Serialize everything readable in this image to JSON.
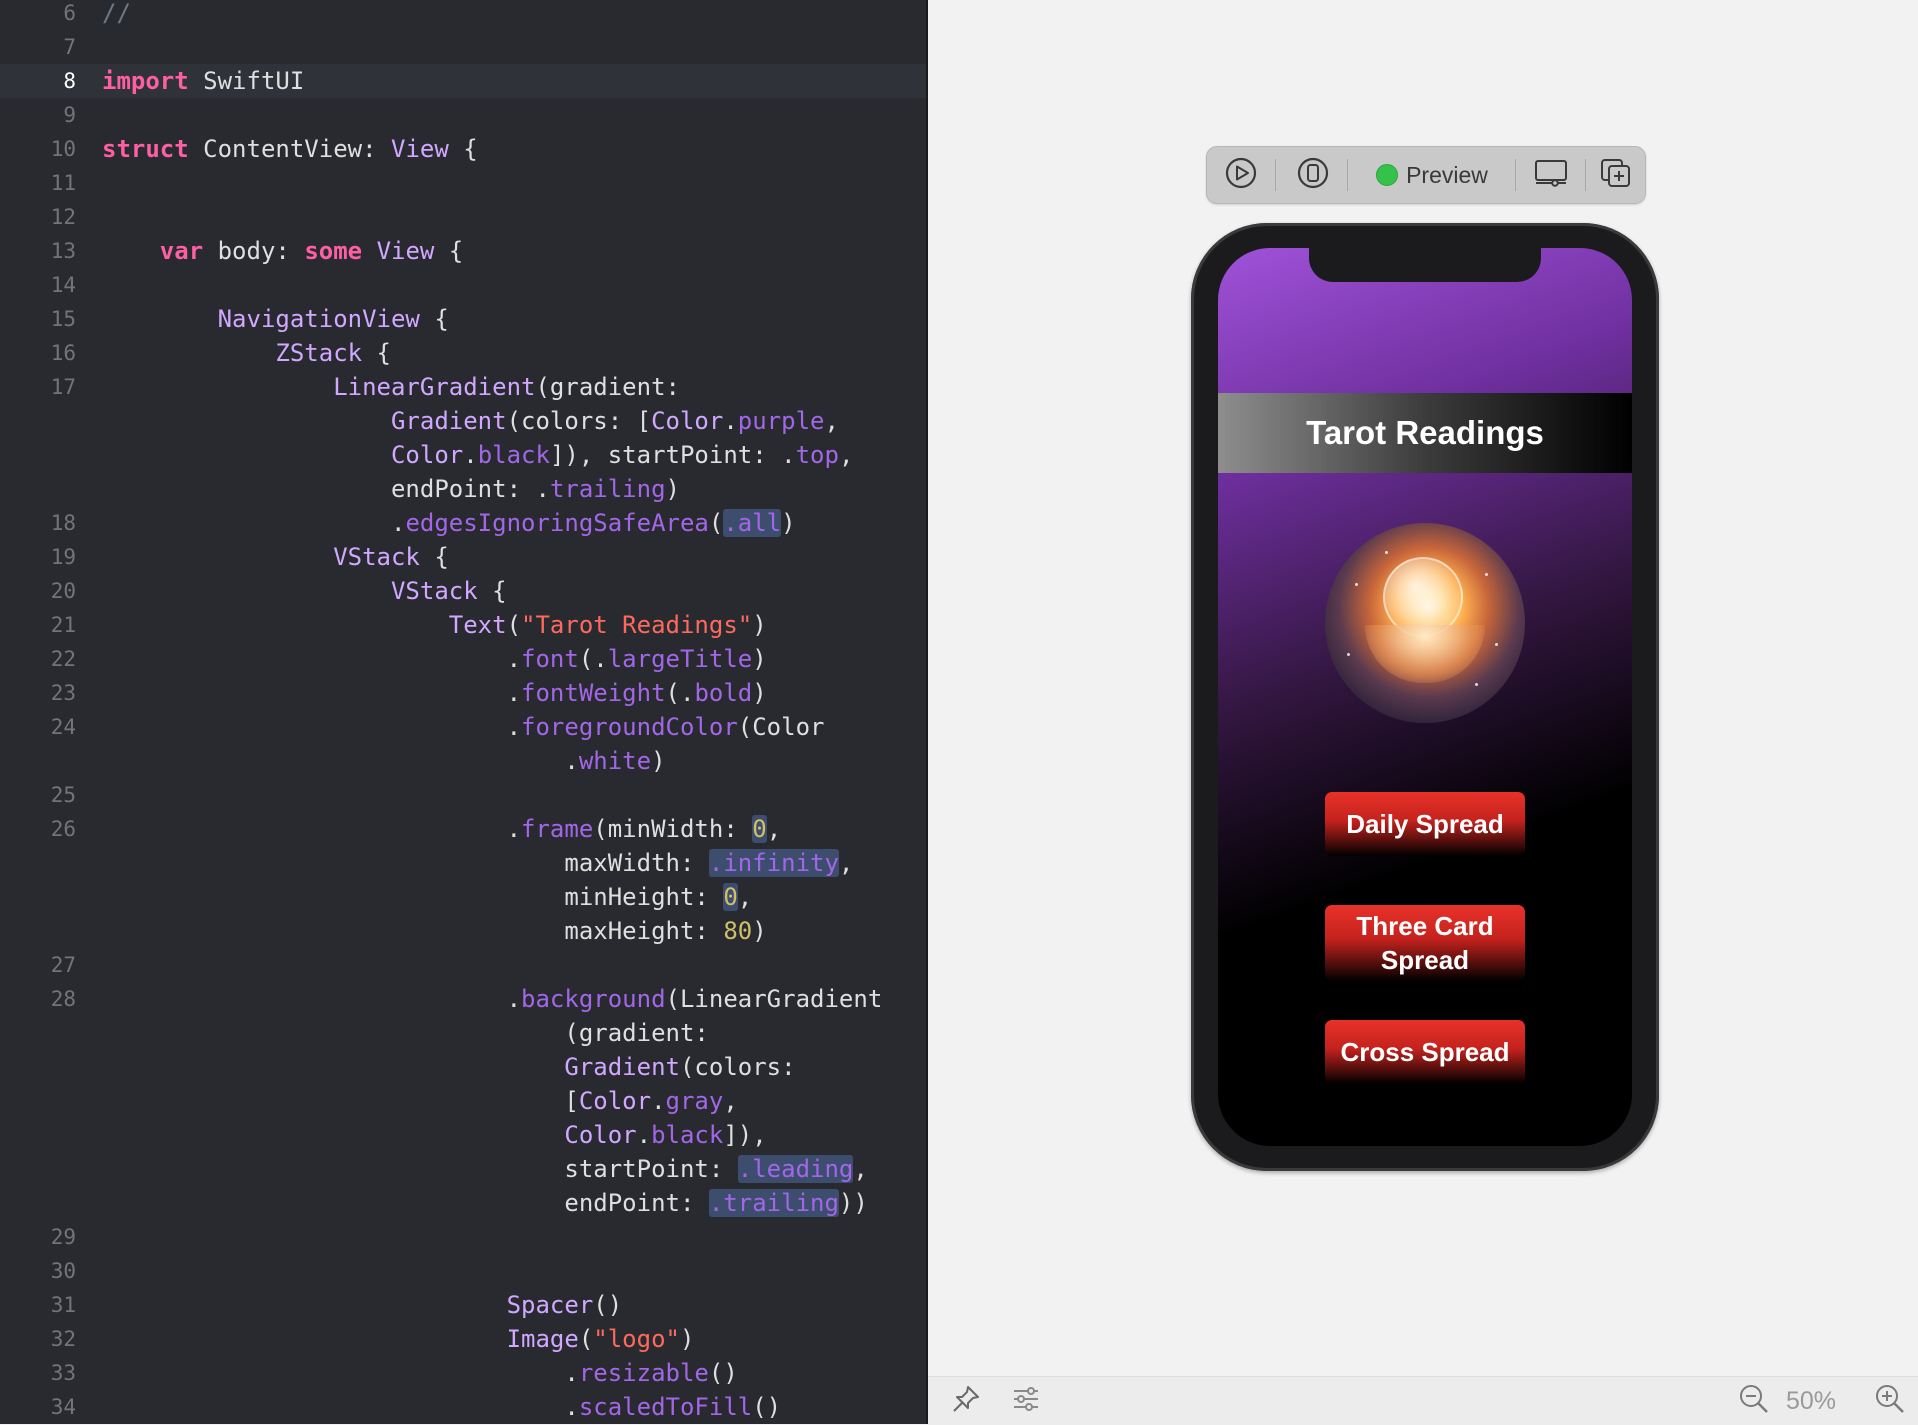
{
  "editor": {
    "lines": [
      {
        "num": "6",
        "tokens": [
          {
            "t": "//",
            "c": "k-com"
          }
        ]
      },
      {
        "num": "7",
        "tokens": []
      },
      {
        "num": "8",
        "current": true,
        "tokens": [
          {
            "t": "import",
            "c": "k-key"
          },
          {
            "t": " SwiftUI"
          }
        ]
      },
      {
        "num": "9",
        "tokens": []
      },
      {
        "num": "10",
        "tokens": [
          {
            "t": "struct",
            "c": "k-key"
          },
          {
            "t": " ContentView: "
          },
          {
            "t": "View",
            "c": "k-type"
          },
          {
            "t": " {"
          }
        ]
      },
      {
        "num": "11",
        "tokens": []
      },
      {
        "num": "12",
        "tokens": []
      },
      {
        "num": "13",
        "tokens": [
          {
            "t": "    "
          },
          {
            "t": "var",
            "c": "k-key"
          },
          {
            "t": " body: "
          },
          {
            "t": "some",
            "c": "k-key"
          },
          {
            "t": " "
          },
          {
            "t": "View",
            "c": "k-type"
          },
          {
            "t": " {"
          }
        ]
      },
      {
        "num": "14",
        "tokens": []
      },
      {
        "num": "15",
        "tokens": [
          {
            "t": "        "
          },
          {
            "t": "NavigationView",
            "c": "k-type"
          },
          {
            "t": " {"
          }
        ]
      },
      {
        "num": "16",
        "tokens": [
          {
            "t": "            "
          },
          {
            "t": "ZStack",
            "c": "k-type"
          },
          {
            "t": " {"
          }
        ]
      },
      {
        "num": "17",
        "tokens": [
          {
            "t": "                "
          },
          {
            "t": "LinearGradient",
            "c": "k-type"
          },
          {
            "t": "(gradient:"
          }
        ]
      },
      {
        "num": "",
        "tokens": [
          {
            "t": "                    "
          },
          {
            "t": "Gradient",
            "c": "k-type"
          },
          {
            "t": "(colors: ["
          },
          {
            "t": "Color",
            "c": "k-type"
          },
          {
            "t": "."
          },
          {
            "t": "purple",
            "c": "k-prop"
          },
          {
            "t": ","
          }
        ]
      },
      {
        "num": "",
        "tokens": [
          {
            "t": "                    "
          },
          {
            "t": "Color",
            "c": "k-type"
          },
          {
            "t": "."
          },
          {
            "t": "black",
            "c": "k-prop"
          },
          {
            "t": "]), startPoint: ."
          },
          {
            "t": "top",
            "c": "k-prop"
          },
          {
            "t": ","
          }
        ]
      },
      {
        "num": "",
        "tokens": [
          {
            "t": "                    endPoint: ."
          },
          {
            "t": "trailing",
            "c": "k-prop"
          },
          {
            "t": ")"
          }
        ]
      },
      {
        "num": "18",
        "tokens": [
          {
            "t": "                    ."
          },
          {
            "t": "edgesIgnoringSafeArea",
            "c": "k-prop"
          },
          {
            "t": "("
          },
          {
            "t": ".all",
            "c": "k-prop hl"
          },
          {
            "t": ")"
          }
        ]
      },
      {
        "num": "19",
        "tokens": [
          {
            "t": "                "
          },
          {
            "t": "VStack",
            "c": "k-type"
          },
          {
            "t": " {"
          }
        ]
      },
      {
        "num": "20",
        "tokens": [
          {
            "t": "                    "
          },
          {
            "t": "VStack",
            "c": "k-type"
          },
          {
            "t": " {"
          }
        ]
      },
      {
        "num": "21",
        "tokens": [
          {
            "t": "                        "
          },
          {
            "t": "Text",
            "c": "k-type"
          },
          {
            "t": "("
          },
          {
            "t": "\"Tarot Readings\"",
            "c": "k-str"
          },
          {
            "t": ")"
          }
        ]
      },
      {
        "num": "22",
        "tokens": [
          {
            "t": "                            ."
          },
          {
            "t": "font",
            "c": "k-prop"
          },
          {
            "t": "(."
          },
          {
            "t": "largeTitle",
            "c": "k-prop"
          },
          {
            "t": ")"
          }
        ]
      },
      {
        "num": "23",
        "tokens": [
          {
            "t": "                            ."
          },
          {
            "t": "fontWeight",
            "c": "k-prop"
          },
          {
            "t": "(."
          },
          {
            "t": "bold",
            "c": "k-prop"
          },
          {
            "t": ")"
          }
        ]
      },
      {
        "num": "24",
        "tokens": [
          {
            "t": "                            ."
          },
          {
            "t": "foregroundColor",
            "c": "k-prop"
          },
          {
            "t": "(Color"
          }
        ]
      },
      {
        "num": "",
        "tokens": [
          {
            "t": "                                ."
          },
          {
            "t": "white",
            "c": "k-prop"
          },
          {
            "t": ")"
          }
        ]
      },
      {
        "num": "25",
        "tokens": []
      },
      {
        "num": "26",
        "tokens": [
          {
            "t": "                            ."
          },
          {
            "t": "frame",
            "c": "k-prop"
          },
          {
            "t": "(minWidth: "
          },
          {
            "t": "0",
            "c": "k-num hl"
          },
          {
            "t": ","
          }
        ]
      },
      {
        "num": "",
        "tokens": [
          {
            "t": "                                maxWidth: "
          },
          {
            "t": ".infinity",
            "c": "k-prop hl"
          },
          {
            "t": ","
          }
        ]
      },
      {
        "num": "",
        "tokens": [
          {
            "t": "                                minHeight: "
          },
          {
            "t": "0",
            "c": "k-num hl"
          },
          {
            "t": ","
          }
        ]
      },
      {
        "num": "",
        "tokens": [
          {
            "t": "                                maxHeight: "
          },
          {
            "t": "80",
            "c": "k-num"
          },
          {
            "t": ")"
          }
        ]
      },
      {
        "num": "27",
        "tokens": []
      },
      {
        "num": "28",
        "tokens": [
          {
            "t": "                            ."
          },
          {
            "t": "background",
            "c": "k-prop"
          },
          {
            "t": "(LinearGradient"
          }
        ]
      },
      {
        "num": "",
        "tokens": [
          {
            "t": "                                (gradient:"
          }
        ]
      },
      {
        "num": "",
        "tokens": [
          {
            "t": "                                "
          },
          {
            "t": "Gradient",
            "c": "k-type"
          },
          {
            "t": "(colors:"
          }
        ]
      },
      {
        "num": "",
        "tokens": [
          {
            "t": "                                ["
          },
          {
            "t": "Color",
            "c": "k-type"
          },
          {
            "t": "."
          },
          {
            "t": "gray",
            "c": "k-prop"
          },
          {
            "t": ","
          }
        ]
      },
      {
        "num": "",
        "tokens": [
          {
            "t": "                                "
          },
          {
            "t": "Color",
            "c": "k-type"
          },
          {
            "t": "."
          },
          {
            "t": "black",
            "c": "k-prop"
          },
          {
            "t": "]),"
          }
        ]
      },
      {
        "num": "",
        "tokens": [
          {
            "t": "                                startPoint: "
          },
          {
            "t": ".leading",
            "c": "k-prop hl"
          },
          {
            "t": ","
          }
        ]
      },
      {
        "num": "",
        "tokens": [
          {
            "t": "                                endPoint: "
          },
          {
            "t": ".trailing",
            "c": "k-prop hl"
          },
          {
            "t": "))"
          }
        ]
      },
      {
        "num": "29",
        "tokens": []
      },
      {
        "num": "30",
        "tokens": []
      },
      {
        "num": "31",
        "tokens": [
          {
            "t": "                            "
          },
          {
            "t": "Spacer",
            "c": "k-type"
          },
          {
            "t": "()"
          }
        ]
      },
      {
        "num": "32",
        "tokens": [
          {
            "t": "                            "
          },
          {
            "t": "Image",
            "c": "k-type"
          },
          {
            "t": "("
          },
          {
            "t": "\"logo\"",
            "c": "k-str"
          },
          {
            "t": ")"
          }
        ]
      },
      {
        "num": "33",
        "tokens": [
          {
            "t": "                                ."
          },
          {
            "t": "resizable",
            "c": "k-prop"
          },
          {
            "t": "()"
          }
        ]
      },
      {
        "num": "34",
        "tokens": [
          {
            "t": "                                ."
          },
          {
            "t": "scaledToFill",
            "c": "k-prop"
          },
          {
            "t": "()"
          }
        ]
      }
    ]
  },
  "preview_toolbar": {
    "live_icon": "play-circle-icon",
    "device_icon": "device-icon",
    "status_dot_color": "#35c24a",
    "preview_label": "Preview",
    "settings_icon": "device-settings-icon",
    "duplicate_icon": "duplicate-icon"
  },
  "app": {
    "title": "Tarot Readings",
    "logo_image": "logo",
    "buttons": [
      "Daily Spread",
      "Three Card Spread",
      "Cross Spread"
    ]
  },
  "bottom_bar": {
    "pin_icon": "pin-icon",
    "adjust_icon": "adjust-icon",
    "zoom_out_icon": "zoom-out-icon",
    "zoom_level": "50%",
    "zoom_in_icon": "zoom-in-icon"
  }
}
